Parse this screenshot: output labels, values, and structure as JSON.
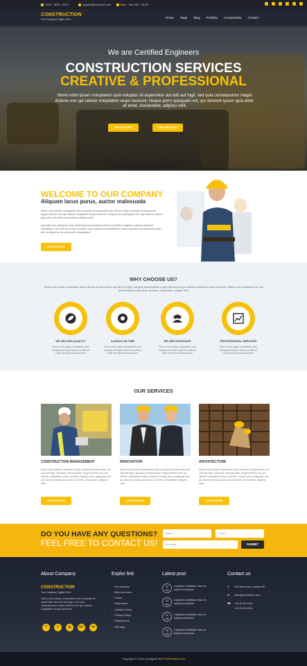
{
  "topbar": {
    "phone": "1234 - 5678 - 9012",
    "email": "support@Contruct.com",
    "hours": "Mon - Sat 9:00 - 19:00",
    "social_icons": [
      "facebook-icon",
      "twitter-icon",
      "behance-icon",
      "vimeo-icon",
      "linkedin-icon",
      "youtube-icon"
    ]
  },
  "nav": {
    "logo_title": "CONSTRUCTION",
    "logo_tagline": "Your Company Tagline Here",
    "menu": [
      "Home",
      "Page",
      "Blog",
      "Portfolio",
      "Components",
      "Contact"
    ]
  },
  "hero": {
    "pre_title": "We are Certified Engineers",
    "title_line1": "CONSTRUCTION SERVICES",
    "title_line2": "CREATIVE & PROFESSIONAL",
    "text": "Nemo enim ipsam voluptatem quia voluptas sit aspernatur aut odit aut fugit, sed quia consequuntur magni dolores eos qui ratione voluptatem sequi nesciunt. Neque porro quisquam est, qui dolorem ipsum quia dolor sit amet, consectetur, adipisci velit,",
    "btn_know_more": "KNOW MORE",
    "btn_view_project": "VIEW PROJECT"
  },
  "welcome": {
    "title": "WELCOME TO OUR COMPANY",
    "subtitle": "Aliquam lacus purus, auctor malesuada",
    "para1": "Nemo enim ipsam voluptatem quia voluptas sit aspernatur aut odit aut fugit, sed quia consequuntur magni dolores eos qui ratione voluptatem sequi nesciunt. Neque porro quisquam est, qui dolorem ipsum quia dolor sit amet, consectetur, adipisci velit.",
    "para2": "sed quia non numquam eius modi tempora incidunt ut labore et dolore magnam aliquam quaerat voluptatem. Ut enim ad minima veniam, quis nostrum exercitationem ullam corporis suscipit laboriosam, nisi ut aliquid ex ea commodi consequatur?",
    "btn": "KNOW MORE"
  },
  "why": {
    "title": "WHY CHOOSE US?",
    "intro": "Nemo enim ipsam voluptatem quia voluptas sit aspernatur aut odit aut fugit, sed quia consequuntur magni dolores eos qui ratione voluptatem sequi nesciunt. Neque porro quisquam est, qui dolorem ipsum quia dolor sit amet, consectetur, adipisci velit.",
    "features": [
      {
        "title": "WE DELIVER QUALITY",
        "icon": "leaf-icon",
        "text": "Nemo enim ipsam voluptatem quia voluptas sit asper natur aut odit aut fugit, sed quia consequuntur"
      },
      {
        "title": "ALWAYS ON TIME",
        "icon": "soccer-ball-icon",
        "text": "Nemo enim ipsam voluptatem quia voluptas sit asper natur aut odit aut fugit, sed quia consequuntur"
      },
      {
        "title": "WE ARE PASIONATE",
        "icon": "team-icon",
        "text": "Nemo enim ipsam voluptatem quia voluptas sit asper natur aut odit aut fugit, sed quia consequuntur"
      },
      {
        "title": "PROFESSIONAL SERVICES",
        "icon": "chart-icon",
        "text": "Nemo enim ipsam voluptatem quia voluptas sit asper natur aut odit aut fugit, sed quia consequuntur"
      }
    ]
  },
  "services": {
    "title": "OUR SERVICES",
    "items": [
      {
        "title": "CONSTRUCTION MANAGEMENT",
        "text": "Nemo enim ipsam voluptatem quia voluptas sit aspernatur aut odit aut fugit, sed quia consequuntur magni dolores eos qui ratione voluptatem sequi nesciunt. Neque porro quisquam est, qui dolorem ipsum quia dolor sit amet, consectetur, adipisci velit.",
        "btn": "KNOW MORE"
      },
      {
        "title": "RENOVATION",
        "text": "Nemo enim ipsam voluptatem quia voluptas sit aspernatur aut odit aut fugit, sed quia consequuntur magni dolores eos qui ratione voluptatem sequi nesciunt. Neque porro quisquam est, qui dolorem ipsum quia dolor sit amet, consectetur, adipisci velit.",
        "btn": "KNOW MORE"
      },
      {
        "title": "ARCHITECTURE",
        "text": "Nemo enim ipsam voluptatem quia voluptas sit aspernatur aut odit aut fugit, sed quia consequuntur magni dolores eos qui ratione voluptatem sequi nesciunt. Neque porro quisquam est, qui dolorem ipsum quia dolor sit amet, consectetur, adipisci velit.",
        "btn": "KNOW MORE"
      }
    ]
  },
  "contact_band": {
    "question": "DO YOU HAVE ANY QUESTIONS?",
    "cta": "FEEL FREE TO CONTACT US!",
    "name_placeholder": "Name",
    "email_placeholder": "Email",
    "message_placeholder": "Message",
    "submit": "SUBMIT"
  },
  "footer": {
    "about": {
      "heading": "About Company",
      "logo_title": "CONSTRUCTION",
      "logo_tagline": "Your Company Tagline Here",
      "text": "Nemo enim ipsam voluptatem quia voluptas sit aspernatur aut odit aut fugit, sed quia consequuntur magni dolores eos qui ratione voluptatem sequi nesciunt.",
      "social": [
        "f",
        "t",
        "◎",
        "G+",
        "in"
      ]
    },
    "links": {
      "heading": "Explor link",
      "items": [
        "Our services",
        "Meet our team",
        "Forum",
        "Help center",
        "Contact Cekas",
        "Privacy Policy",
        "Cekas terms",
        "Site map"
      ]
    },
    "posts": {
      "heading": "Latest post",
      "items": [
        {
          "date": "20",
          "month": "Jan",
          "line1": "Luptatum omittantur duo ne",
          "line2": "mpetus indoctum"
        },
        {
          "date": "20",
          "month": "Jan",
          "line1": "Luptatum omittantur duo ne",
          "line2": "mpetus indoctum"
        },
        {
          "date": "20",
          "month": "Jan",
          "line1": "Luptatum omittantur duo ne",
          "line2": "mpetus indoctum"
        },
        {
          "date": "20",
          "month": "Jan",
          "line1": "Luptatum omittantur duo ne",
          "line2": "mpetus indoctum"
        }
      ]
    },
    "contact": {
      "heading": "Contact us",
      "address": "124 New Line, London UK",
      "email": "hello@pxfreebies.com",
      "phone1": "+44 00 00 1234",
      "phone2": "+44 00 00 1234"
    },
    "copyright_prefix": "Copyright © 2016 | Designed By ",
    "copyright_brand": "PSDFreebies.com"
  },
  "colors": {
    "accent": "#f5c10a",
    "dark": "#242634"
  }
}
